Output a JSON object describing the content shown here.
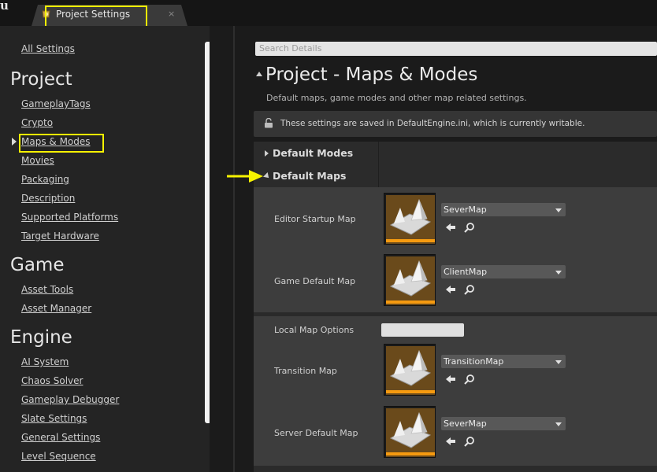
{
  "window": {
    "logo_glyph": "u",
    "tab": {
      "label": "Project Settings",
      "close_glyph": "×",
      "icon": "settings-icon"
    }
  },
  "sidebar": {
    "top_link": "All Settings",
    "sections": [
      {
        "header": "Project",
        "items": [
          "GameplayTags",
          "Crypto",
          "Maps & Modes",
          "Movies",
          "Packaging",
          "Description",
          "Supported Platforms",
          "Target Hardware"
        ]
      },
      {
        "header": "Game",
        "items": [
          "Asset Tools",
          "Asset Manager"
        ]
      },
      {
        "header": "Engine",
        "items": [
          "AI System",
          "Chaos Solver",
          "Gameplay Debugger",
          "Slate Settings",
          "General Settings",
          "Level Sequence"
        ]
      }
    ],
    "selected": "Maps & Modes"
  },
  "details": {
    "search_placeholder": "Search Details",
    "title": "Project - Maps & Modes",
    "description": "Default maps, game modes and other map related settings.",
    "notice": "These settings are saved in DefaultEngine.ini, which is currently writable.",
    "categories": [
      {
        "label": "Default Modes",
        "expanded": false
      },
      {
        "label": "Default Maps",
        "expanded": true
      }
    ],
    "properties": [
      {
        "label": "Editor Startup Map",
        "value": "SeverMap"
      },
      {
        "label": "Game Default Map",
        "value": "ClientMap"
      },
      {
        "label": "Local Map Options",
        "value": ""
      },
      {
        "label": "Transition Map",
        "value": "TransitionMap"
      },
      {
        "label": "Server Default Map",
        "value": "SeverMap"
      }
    ]
  },
  "annotations": {
    "highlight_color": "#f6f200"
  },
  "colors": {
    "asset_accent": "#f59a10",
    "panel": "#3d3d3d",
    "background": "#1b1b1b"
  }
}
